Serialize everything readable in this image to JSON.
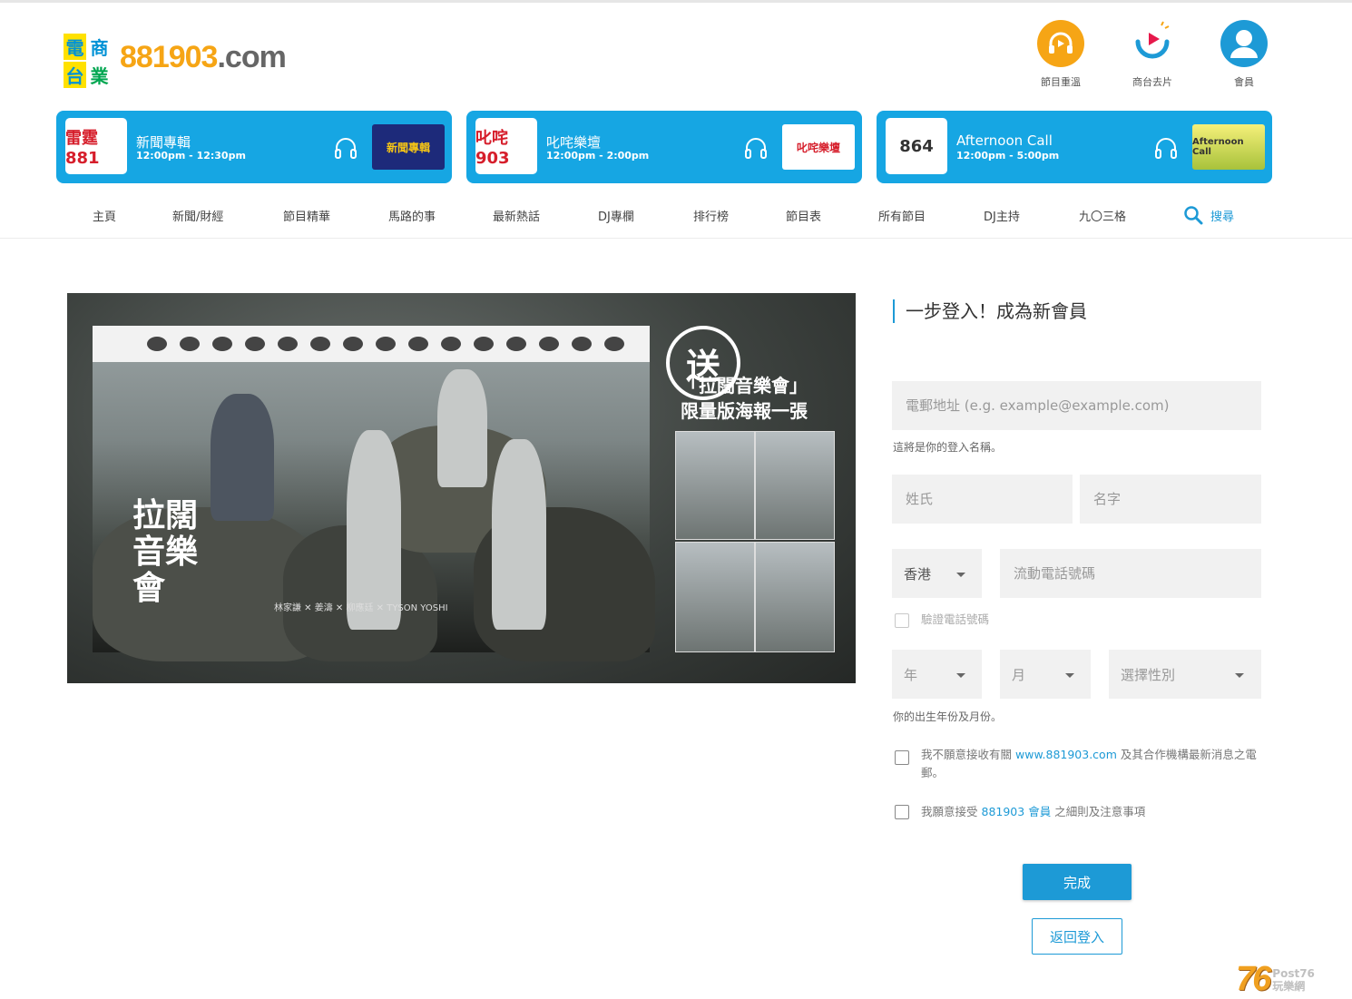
{
  "logo": {
    "mark": [
      "電",
      "商",
      "台",
      "業"
    ],
    "num": "881903",
    "dom": ".com"
  },
  "header_icons": [
    {
      "label": "節目重溫",
      "icon": "replay-headphones-icon",
      "color": "#f6a515"
    },
    {
      "label": "商台去片",
      "icon": "video-play-icon",
      "color": "#1d9ad6"
    },
    {
      "label": "會員",
      "icon": "member-user-icon",
      "color": "#1d9ad6"
    }
  ],
  "stations": [
    {
      "logo": "雷霆881",
      "name": "新聞專輯",
      "time": "12:00pm - 12:30pm",
      "thumb": "新聞專輯"
    },
    {
      "logo": "叱咤903",
      "name": "叱咤樂壇",
      "time": "12:00pm - 2:00pm",
      "thumb": "叱咤樂壇"
    },
    {
      "logo": "864",
      "name": "Afternoon Call",
      "time": "12:00pm - 5:00pm",
      "thumb": "Afternoon Call"
    }
  ],
  "nav": {
    "items": [
      "主頁",
      "新聞/財經",
      "節目精華",
      "馬路的事",
      "最新熱話",
      "DJ專欄",
      "排行榜",
      "節目表",
      "所有節目",
      "DJ主持",
      "九〇三格"
    ],
    "search": "搜尋"
  },
  "promo": {
    "title": "拉闊音樂會",
    "artists": "林家謙 ✕ 姜濤 ✕ 柳應廷 ✕ TYSON YOSHI",
    "send": "送",
    "offer_line1": "「拉闊音樂會」",
    "offer_line2": "限量版海報一張"
  },
  "form": {
    "title": "一步登入！成為新會員",
    "email_placeholder": "電郵地址 (e.g. example@example.com)",
    "email_hint": "這將是你的登入名稱。",
    "surname_placeholder": "姓氏",
    "given_name_placeholder": "名字",
    "region_value": "香港",
    "phone_placeholder": "流動電話號碼",
    "verify_phone_label": "驗證電話號碼",
    "year_placeholder": "年",
    "month_placeholder": "月",
    "gender_placeholder": "選擇性別",
    "birth_hint": "你的出生年份及月份。",
    "optout_pre": "我不願意接收有關",
    "optout_link": "www.881903.com",
    "optout_post": "及其合作機構最新消息之電郵。",
    "terms_pre": "我願意接受",
    "terms_link": "881903 會員",
    "terms_post": "之細則及注意事項",
    "submit_label": "完成",
    "back_label": "返回登入"
  },
  "watermark": {
    "big": "76",
    "small_top": "Post76",
    "small_bottom": "玩樂網"
  }
}
